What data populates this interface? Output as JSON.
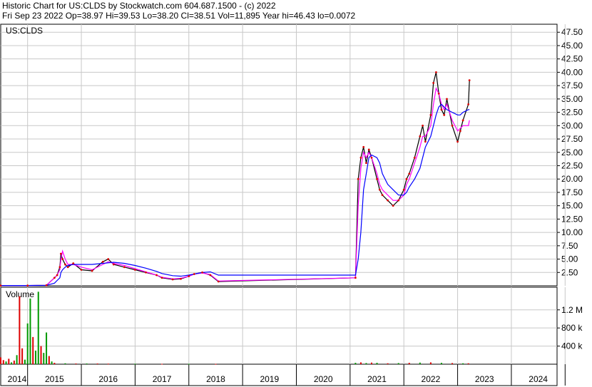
{
  "header": {
    "title": "Historic Chart for US:CLDS by Stockwatch.com 604.687.1500 - (c) 2022",
    "stats": "Fri Sep 23 2022  Op=38.97  Hi=39.53  Lo=38.20  Cl=38.51  Vol=11,895  Year hi=46.43  lo=0.0072"
  },
  "colors": {
    "grid": "#c8c8c8",
    "ma_short": "#ff00ff",
    "ma_long": "#0000ff",
    "price": "#000000",
    "up": "#009900",
    "down": "#dd0000"
  },
  "chart_data": [
    {
      "type": "line",
      "symbol_label": "US:CLDS",
      "ylim": [
        0,
        49
      ],
      "y_ticks": [
        "2.50",
        "5.00",
        "7.50",
        "10.00",
        "12.50",
        "15.00",
        "17.50",
        "20.00",
        "22.50",
        "25.00",
        "27.50",
        "30.00",
        "32.50",
        "35.00",
        "37.50",
        "40.00",
        "42.50",
        "45.00",
        "47.50"
      ],
      "x_ticks": [
        "2014",
        "2015",
        "2016",
        "2017",
        "2018",
        "2019",
        "2020",
        "2021",
        "2022",
        "2023",
        "2024"
      ],
      "x": [
        2014.0,
        2014.5,
        2014.85,
        2015.0,
        2015.05,
        2015.1,
        2015.12,
        2015.15,
        2015.2,
        2015.25,
        2015.35,
        2015.5,
        2015.7,
        2015.9,
        2016.0,
        2016.1,
        2016.3,
        2016.5,
        2016.7,
        2016.9,
        2017.0,
        2017.2,
        2017.35,
        2017.5,
        2017.6,
        2017.75,
        2017.9,
        2018.05,
        2020.6,
        2020.65,
        2020.7,
        2020.75,
        2020.8,
        2020.85,
        2020.9,
        2021.0,
        2021.05,
        2021.1,
        2021.2,
        2021.3,
        2021.4,
        2021.5,
        2021.55,
        2021.6,
        2021.7,
        2021.8,
        2021.85,
        2021.9,
        2022.0,
        2022.05,
        2022.1,
        2022.15,
        2022.2,
        2022.25,
        2022.3,
        2022.4,
        2022.5,
        2022.55,
        2022.6,
        2022.7,
        2022.72
      ],
      "series": [
        {
          "values": [
            0.05,
            0.05,
            0.1,
            1.5,
            2.0,
            3.5,
            6.0,
            5.0,
            4.0,
            3.5,
            4.2,
            3.0,
            2.8,
            4.5,
            5.0,
            4.0,
            3.5,
            3.0,
            2.5,
            2.0,
            1.5,
            1.2,
            1.3,
            1.8,
            2.2,
            2.5,
            2.0,
            0.8,
            1.5,
            20.0,
            24.0,
            26.0,
            23.0,
            25.5,
            24.0,
            20.0,
            18.0,
            17.0,
            16.0,
            15.0,
            16.0,
            18.0,
            20.0,
            21.0,
            24.0,
            28.0,
            30.0,
            27.0,
            32.0,
            38.0,
            40.0,
            36.0,
            33.0,
            32.0,
            35.0,
            30.0,
            27.0,
            29.0,
            31.0,
            34.0,
            38.5
          ]
        },
        {
          "values": [
            0.05,
            0.05,
            0.1,
            1.5,
            2.0,
            3.0,
            5.0,
            6.5,
            5.0,
            4.0,
            4.0,
            3.5,
            3.0,
            4.0,
            4.5,
            4.2,
            3.8,
            3.2,
            2.6,
            2.0,
            1.6,
            1.3,
            1.4,
            1.8,
            2.2,
            2.4,
            2.1,
            0.9,
            1.5,
            15.0,
            22.0,
            25.0,
            24.0,
            25.0,
            24.0,
            21.0,
            19.0,
            18.0,
            17.0,
            16.0,
            16.0,
            17.0,
            19.0,
            20.0,
            23.0,
            26.0,
            28.0,
            28.0,
            30.0,
            34.0,
            37.0,
            36.0,
            34.0,
            33.0,
            34.0,
            31.0,
            29.0,
            29.5,
            30.0,
            30.0,
            31.0
          ]
        },
        {
          "values": [
            0.05,
            0.05,
            0.1,
            0.5,
            1.0,
            1.5,
            2.5,
            3.0,
            3.5,
            3.8,
            4.0,
            4.0,
            4.0,
            4.2,
            4.3,
            4.4,
            4.2,
            3.8,
            3.3,
            2.7,
            2.3,
            1.9,
            1.8,
            2.0,
            2.2,
            2.5,
            2.6,
            2.0,
            2.0,
            5.0,
            10.0,
            18.0,
            21.0,
            24.0,
            24.5,
            24.0,
            23.0,
            21.0,
            19.0,
            18.0,
            17.0,
            17.0,
            17.5,
            18.5,
            20.0,
            22.0,
            24.0,
            26.0,
            28.0,
            30.0,
            32.0,
            33.5,
            34.0,
            33.5,
            33.0,
            32.5,
            32.0,
            32.0,
            32.5,
            33.0,
            33.0
          ]
        }
      ]
    },
    {
      "type": "bar",
      "title": "Volume",
      "ylim": [
        0,
        1700000
      ],
      "y_ticks": [
        "400 k",
        "800 k",
        "1.2 M"
      ],
      "y_tick_values": [
        400000,
        800000,
        1200000
      ],
      "x": [
        2014.0,
        2014.05,
        2014.1,
        2014.15,
        2014.2,
        2014.25,
        2014.3,
        2014.35,
        2014.4,
        2014.45,
        2014.5,
        2014.55,
        2014.6,
        2014.65,
        2014.7,
        2014.75,
        2014.8,
        2014.85,
        2014.9,
        2014.95,
        2015.0,
        2015.2,
        2015.4,
        2015.6,
        2015.8,
        2016.0,
        2016.5,
        2017.0,
        2017.5,
        2018.0,
        2020.6,
        2020.7,
        2020.8,
        2020.9,
        2021.0,
        2021.2,
        2021.4,
        2021.6,
        2021.8,
        2022.0,
        2022.2,
        2022.4,
        2022.6,
        2022.7
      ],
      "values": [
        150000,
        90000,
        60000,
        120000,
        40000,
        80000,
        200000,
        1500000,
        350000,
        100000,
        900000,
        1450000,
        600000,
        300000,
        1600000,
        400000,
        250000,
        700000,
        180000,
        60000,
        30000,
        20000,
        15000,
        15000,
        15000,
        12000,
        10000,
        8000,
        8000,
        6000,
        30000,
        40000,
        25000,
        35000,
        30000,
        20000,
        25000,
        30000,
        35000,
        40000,
        30000,
        25000,
        20000,
        20000
      ],
      "colors": [
        "#dd0000",
        "#dd0000",
        "#009900",
        "#dd0000",
        "#009900",
        "#dd0000",
        "#009900",
        "#dd0000",
        "#dd0000",
        "#009900",
        "#009900",
        "#009900",
        "#dd0000",
        "#009900",
        "#009900",
        "#dd0000",
        "#009900",
        "#009900",
        "#dd0000",
        "#009900",
        "#dd0000",
        "#009900",
        "#dd0000",
        "#009900",
        "#dd0000",
        "#dd0000",
        "#009900",
        "#dd0000",
        "#009900",
        "#dd0000",
        "#009900",
        "#dd0000",
        "#009900",
        "#dd0000",
        "#009900",
        "#dd0000",
        "#009900",
        "#dd0000",
        "#009900",
        "#dd0000",
        "#009900",
        "#dd0000",
        "#009900",
        "#dd0000"
      ]
    }
  ]
}
